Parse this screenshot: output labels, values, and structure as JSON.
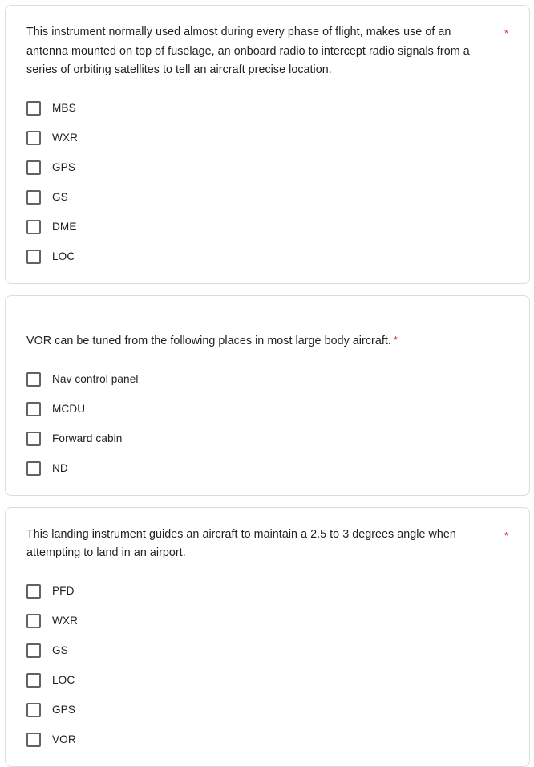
{
  "form": {
    "required_marker": "*",
    "accent_required_color": "#d93025",
    "card_border_color": "#dadce0",
    "text_color": "#202124",
    "checkbox_border_color": "#5f6368",
    "questions": [
      {
        "id": "q1",
        "text": "This instrument normally used almost during every phase of flight, makes use of an antenna mounted on top of fuselage, an onboard radio to intercept radio signals from a series of orbiting satellites to tell an aircraft precise location.",
        "required": true,
        "star_position": "right",
        "options": [
          {
            "label": "MBS",
            "checked": false
          },
          {
            "label": "WXR",
            "checked": false
          },
          {
            "label": "GPS",
            "checked": false
          },
          {
            "label": "GS",
            "checked": false
          },
          {
            "label": "DME",
            "checked": false
          },
          {
            "label": "LOC",
            "checked": false
          }
        ]
      },
      {
        "id": "q2",
        "text": "VOR can be tuned from the following places in most large body aircraft.",
        "required": true,
        "star_position": "inline",
        "options": [
          {
            "label": "Nav control panel",
            "checked": false
          },
          {
            "label": "MCDU",
            "checked": false
          },
          {
            "label": "Forward cabin",
            "checked": false
          },
          {
            "label": "ND",
            "checked": false
          }
        ]
      },
      {
        "id": "q3",
        "text": "This landing instrument guides an aircraft to maintain a 2.5 to 3 degrees angle when attempting to land in an airport.",
        "required": true,
        "star_position": "right",
        "options": [
          {
            "label": "PFD",
            "checked": false
          },
          {
            "label": "WXR",
            "checked": false
          },
          {
            "label": "GS",
            "checked": false
          },
          {
            "label": "LOC",
            "checked": false
          },
          {
            "label": "GPS",
            "checked": false
          },
          {
            "label": "VOR",
            "checked": false
          }
        ]
      }
    ]
  }
}
